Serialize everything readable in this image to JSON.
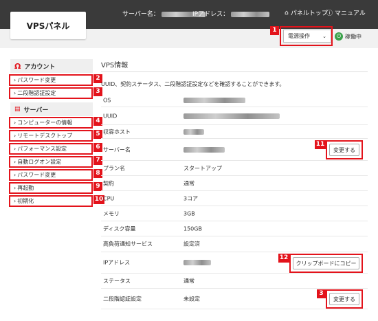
{
  "header": {
    "logo": "VPSパネル",
    "server_name_label": "サーバー名：",
    "ip_label": "IPアドレス：",
    "panel_top": "パネルトップ",
    "manual": "マニュアル"
  },
  "toolbar": {
    "power_select": "電源操作",
    "status": "稼働中"
  },
  "sidebar": {
    "account_head": "アカウント",
    "account_items": [
      "パスワード変更",
      "二段階認証設定"
    ],
    "server_head": "サーバー",
    "server_items": [
      "コンピューターの情報",
      "リモートデスクトップ",
      "パフォーマンス設定",
      "自動ログオン設定",
      "パスワード変更",
      "再起動",
      "初期化"
    ]
  },
  "main": {
    "title": "VPS情報",
    "description": "UUID、契約ステータス、二段階認証設定などを確認することができます。",
    "rows": [
      {
        "key": "OS",
        "value": ""
      },
      {
        "key": "UUID",
        "value": ""
      },
      {
        "key": "収容ホスト",
        "value": ""
      },
      {
        "key": "サーバー名",
        "value": ""
      },
      {
        "key": "プラン名",
        "value": "スタートアップ"
      },
      {
        "key": "契約",
        "value": "通常"
      },
      {
        "key": "CPU",
        "value": "3コア"
      },
      {
        "key": "メモリ",
        "value": "3GB"
      },
      {
        "key": "ディスク容量",
        "value": "150GB"
      },
      {
        "key": "高負荷通知サービス",
        "value": "設定済"
      },
      {
        "key": "IPアドレス",
        "value": ""
      },
      {
        "key": "ステータス",
        "value": "通常"
      },
      {
        "key": "二段階認証設定",
        "value": "未設定"
      }
    ],
    "change_button": "変更する",
    "copy_button": "クリップボードにコピー",
    "change_button_2": "変更する"
  },
  "annotations": [
    "1",
    "2",
    "3",
    "4",
    "5",
    "6",
    "7",
    "8",
    "9",
    "10",
    "11",
    "12",
    "3"
  ],
  "colors": {
    "accent": "#e3131b",
    "topbar": "#3a3a3a",
    "running": "#3aa14a"
  }
}
